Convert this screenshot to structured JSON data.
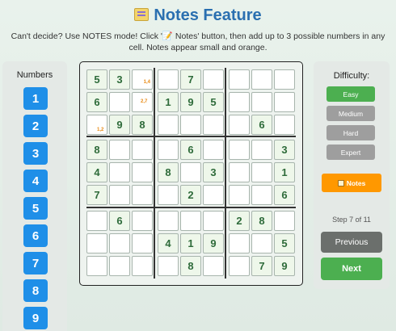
{
  "header": {
    "title": "Notes Feature",
    "subtitle": "Can't decide? Use NOTES mode! Click '📝 Notes' button, then add up to 3 possible numbers in any cell. Notes appear small and orange."
  },
  "numbers_panel": {
    "title": "Numbers",
    "buttons": [
      "1",
      "2",
      "3",
      "4",
      "5",
      "6",
      "7",
      "8",
      "9"
    ]
  },
  "board": {
    "grid": [
      [
        "5",
        "3",
        "",
        "",
        "7",
        "",
        "",
        "",
        ""
      ],
      [
        "6",
        "",
        "",
        "1",
        "9",
        "5",
        "",
        "",
        ""
      ],
      [
        "",
        "9",
        "8",
        "",
        "",
        "",
        "",
        "6",
        ""
      ],
      [
        "8",
        "",
        "",
        "",
        "6",
        "",
        "",
        "",
        "3"
      ],
      [
        "4",
        "",
        "",
        "8",
        "",
        "3",
        "",
        "",
        "1"
      ],
      [
        "7",
        "",
        "",
        "",
        "2",
        "",
        "",
        "",
        "6"
      ],
      [
        "",
        "6",
        "",
        "",
        "",
        "",
        "2",
        "8",
        ""
      ],
      [
        "",
        "",
        "",
        "4",
        "1",
        "9",
        "",
        "",
        "5"
      ],
      [
        "",
        "",
        "",
        "",
        "8",
        "",
        "",
        "7",
        "9"
      ]
    ],
    "notes": [
      {
        "row": 0,
        "col": 2,
        "text": "1,4"
      },
      {
        "row": 1,
        "col": 2,
        "text": "2,7"
      },
      {
        "row": 2,
        "col": 0,
        "text": "1,2"
      }
    ]
  },
  "right_panel": {
    "difficulty_title": "Difficulty:",
    "difficulties": [
      {
        "label": "Easy",
        "color": "#4caf50"
      },
      {
        "label": "Medium",
        "color": "#9e9e9e"
      },
      {
        "label": "Hard",
        "color": "#9e9e9e"
      },
      {
        "label": "Expert",
        "color": "#9e9e9e"
      }
    ],
    "notes_label": "Notes",
    "step_text": "Step 7 of 11",
    "previous_label": "Previous",
    "next_label": "Next"
  },
  "colors": {
    "accent_blue": "#1f8fe8",
    "notes_orange": "#ff9800",
    "note_text": "#e88a12",
    "selected_green": "#4caf50"
  }
}
